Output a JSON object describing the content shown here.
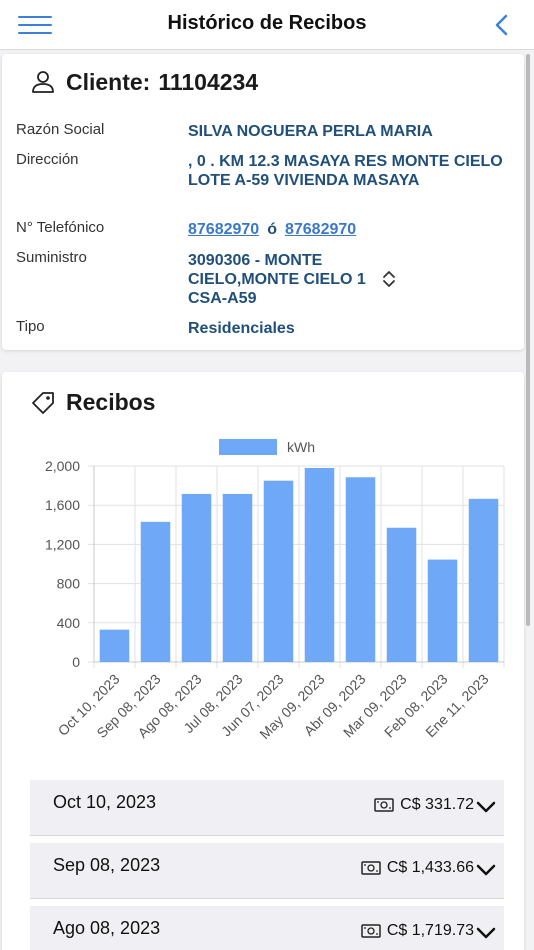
{
  "header": {
    "title": "Histórico de Recibos"
  },
  "client": {
    "title_label": "Cliente:",
    "number": "11104234",
    "fields": {
      "razon_label": "Razón Social",
      "razon_value": "SILVA NOGUERA PERLA MARIA",
      "direccion_label": "Dirección",
      "direccion_value": ", 0 . KM 12.3 MASAYA RES MONTE CIELO LOTE A-59 VIVIENDA MASAYA",
      "telefono_label": "N° Telefónico",
      "telefono_1": "87682970",
      "telefono_sep": "ó",
      "telefono_2": "87682970",
      "suministro_label": "Suministro",
      "suministro_value": "3090306 - MONTE CIELO,MONTE CIELO 1 CSA-A59",
      "tipo_label": "Tipo",
      "tipo_value": "Residenciales"
    }
  },
  "receipts": {
    "title": "Recibos",
    "items": [
      {
        "date": "Oct 10, 2023",
        "amount": "C$ 331.72"
      },
      {
        "date": "Sep 08, 2023",
        "amount": "C$ 1,433.66"
      },
      {
        "date": "Ago 08, 2023",
        "amount": "C$ 1,719.73"
      }
    ]
  },
  "colors": {
    "accent": "#3b82d6",
    "bar": "#6fa8f7",
    "value_text": "#1f4f7a"
  },
  "chart_data": {
    "type": "bar",
    "categories": [
      "Oct 10, 2023",
      "Sep 08, 2023",
      "Ago 08, 2023",
      "Jul 08, 2023",
      "Jun 07, 2023",
      "May 09, 2023",
      "Abr 09, 2023",
      "Mar 09, 2023",
      "Feb 08, 2023",
      "Ene 11, 2023"
    ],
    "series": [
      {
        "name": "kWh",
        "values": [
          330,
          1430,
          1715,
          1715,
          1850,
          1980,
          1885,
          1370,
          1045,
          1665
        ]
      }
    ],
    "yticks": [
      "0",
      "400",
      "800",
      "1,200",
      "1,600",
      "2,000"
    ],
    "ylim": [
      0,
      2000
    ],
    "grid": true,
    "legend": "top"
  }
}
